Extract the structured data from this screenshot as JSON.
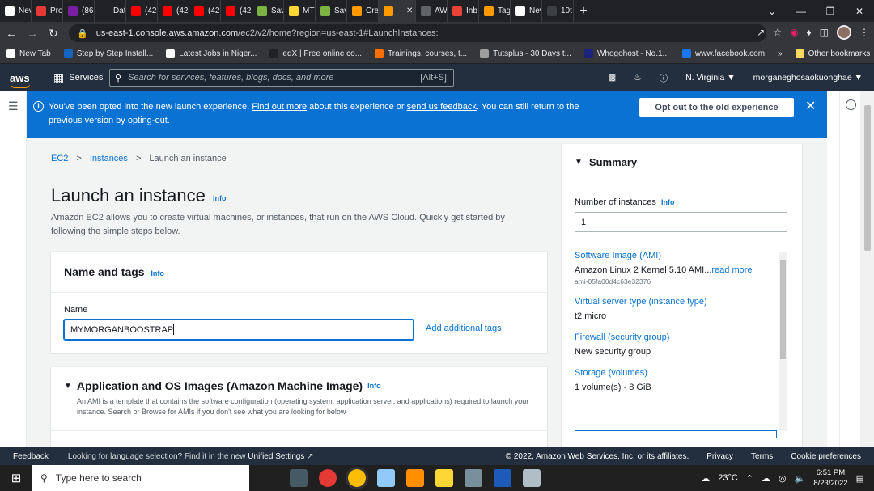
{
  "browser": {
    "tabs": [
      {
        "label": "Nev",
        "icon": "github-icon",
        "color": "#ffffff"
      },
      {
        "label": "Pro",
        "icon": "app-icon",
        "color": "#e53935"
      },
      {
        "label": "(86",
        "icon": "yahoo-icon",
        "color": "#7b1fa2"
      },
      {
        "label": "Dat",
        "icon": "x-icon",
        "color": "#202124"
      },
      {
        "label": "(42",
        "icon": "youtube-icon",
        "color": "#ff0000"
      },
      {
        "label": "(42",
        "icon": "youtube-icon",
        "color": "#ff0000"
      },
      {
        "label": "(42",
        "icon": "youtube-icon",
        "color": "#ff0000"
      },
      {
        "label": "(42",
        "icon": "youtube-icon",
        "color": "#ff0000"
      },
      {
        "label": "Sav",
        "icon": "download-icon",
        "color": "#7cb342"
      },
      {
        "label": "MTI",
        "icon": "mtn-icon",
        "color": "#fdd835"
      },
      {
        "label": "Sav",
        "icon": "download-icon",
        "color": "#7cb342"
      },
      {
        "label": "Cre",
        "icon": "aws-cube-icon",
        "color": "#ff9900"
      },
      {
        "label": "",
        "icon": "aws-cube-icon",
        "color": "#ff9900",
        "active": true
      },
      {
        "label": "AW",
        "icon": "terminal-icon",
        "color": "#5f6368"
      },
      {
        "label": "Inb",
        "icon": "gmail-icon",
        "color": "#ea4335"
      },
      {
        "label": "Tag",
        "icon": "aws-cube-icon",
        "color": "#ff9900"
      },
      {
        "label": "Nev",
        "icon": "github-icon",
        "color": "#ffffff"
      },
      {
        "label": "10t",
        "icon": "github-icon",
        "color": "#3c4043"
      }
    ],
    "url_host": "us-east-1.console.aws.amazon.com",
    "url_path": "/ec2/v2/home?region=us-east-1#LaunchInstances:",
    "bookmarks": [
      {
        "label": "New Tab",
        "color": "#ffffff"
      },
      {
        "label": "Step by Step Install...",
        "color": "#1565c0"
      },
      {
        "label": "Latest Jobs in Niger...",
        "color": "#ffffff"
      },
      {
        "label": "edX | Free online co...",
        "color": "#202124"
      },
      {
        "label": "Trainings, courses, t...",
        "color": "#ff6f00"
      },
      {
        "label": "Tutsplus - 30 Days t...",
        "color": "#9e9e9e"
      },
      {
        "label": "Whogohost - No.1...",
        "color": "#1a237e"
      },
      {
        "label": "www.facebook.com",
        "color": "#1877f2"
      }
    ],
    "more_bookmarks": "»",
    "other_bookmarks": "Other bookmarks"
  },
  "aws_nav": {
    "logo": "aws",
    "services": "Services",
    "search_placeholder": "Search for services, features, blogs, docs, and more",
    "search_shortcut": "[Alt+S]",
    "region": "N. Virginia ▼",
    "account": "morganeghosaokuonghae ▼"
  },
  "banner": {
    "text_before": "You've been opted into the new launch experience.",
    "link1": "Find out more",
    "text_middle": "about this experience or",
    "link2": "send us feedback",
    "text_after": ". You can still return to the",
    "text_line2": "previous version by opting-out.",
    "button": "Opt out to the old experience"
  },
  "breadcrumb": {
    "items": [
      "EC2",
      "Instances",
      "Launch an instance"
    ],
    "sep": ">"
  },
  "page": {
    "title": "Launch an instance",
    "info": "Info",
    "description": "Amazon EC2 allows you to create virtual machines, or instances, that run on the AWS Cloud. Quickly get started by following the simple steps below."
  },
  "name_tags": {
    "title": "Name and tags",
    "info": "Info",
    "label": "Name",
    "value": "MYMORGANBOOSTRAP",
    "add_tags": "Add additional tags"
  },
  "ami": {
    "title": "Application and OS Images (Amazon Machine Image)",
    "info": "Info",
    "description": "An AMI is a template that contains the software configuration (operating system, application server, and applications) required to launch your instance. Search or Browse for AMIs if you don't see what you are looking for below"
  },
  "summary": {
    "title": "Summary",
    "instances_label": "Number of instances",
    "info": "Info",
    "instances_value": "1",
    "items": [
      {
        "key": "Software Image (AMI)",
        "value": "Amazon Linux 2 Kernel 5.10 AMI...",
        "more": "read more",
        "sub": "ami-05fa00d4c63e32376"
      },
      {
        "key": "Virtual server type (instance type)",
        "value": "t2.micro"
      },
      {
        "key": "Firewall (security group)",
        "value": "New security group"
      },
      {
        "key": "Storage (volumes)",
        "value": "1 volume(s) - 8 GiB"
      }
    ]
  },
  "footer": {
    "feedback": "Feedback",
    "lang_text": "Looking for language selection? Find it in the new",
    "lang_link": "Unified Settings",
    "copyright": "© 2022, Amazon Web Services, Inc. or its affiliates.",
    "privacy": "Privacy",
    "terms": "Terms",
    "cookies": "Cookie preferences"
  },
  "taskbar": {
    "search_placeholder": "Type here to search",
    "temperature": "23°C",
    "time": "6:51 PM",
    "date": "8/23/2022"
  }
}
